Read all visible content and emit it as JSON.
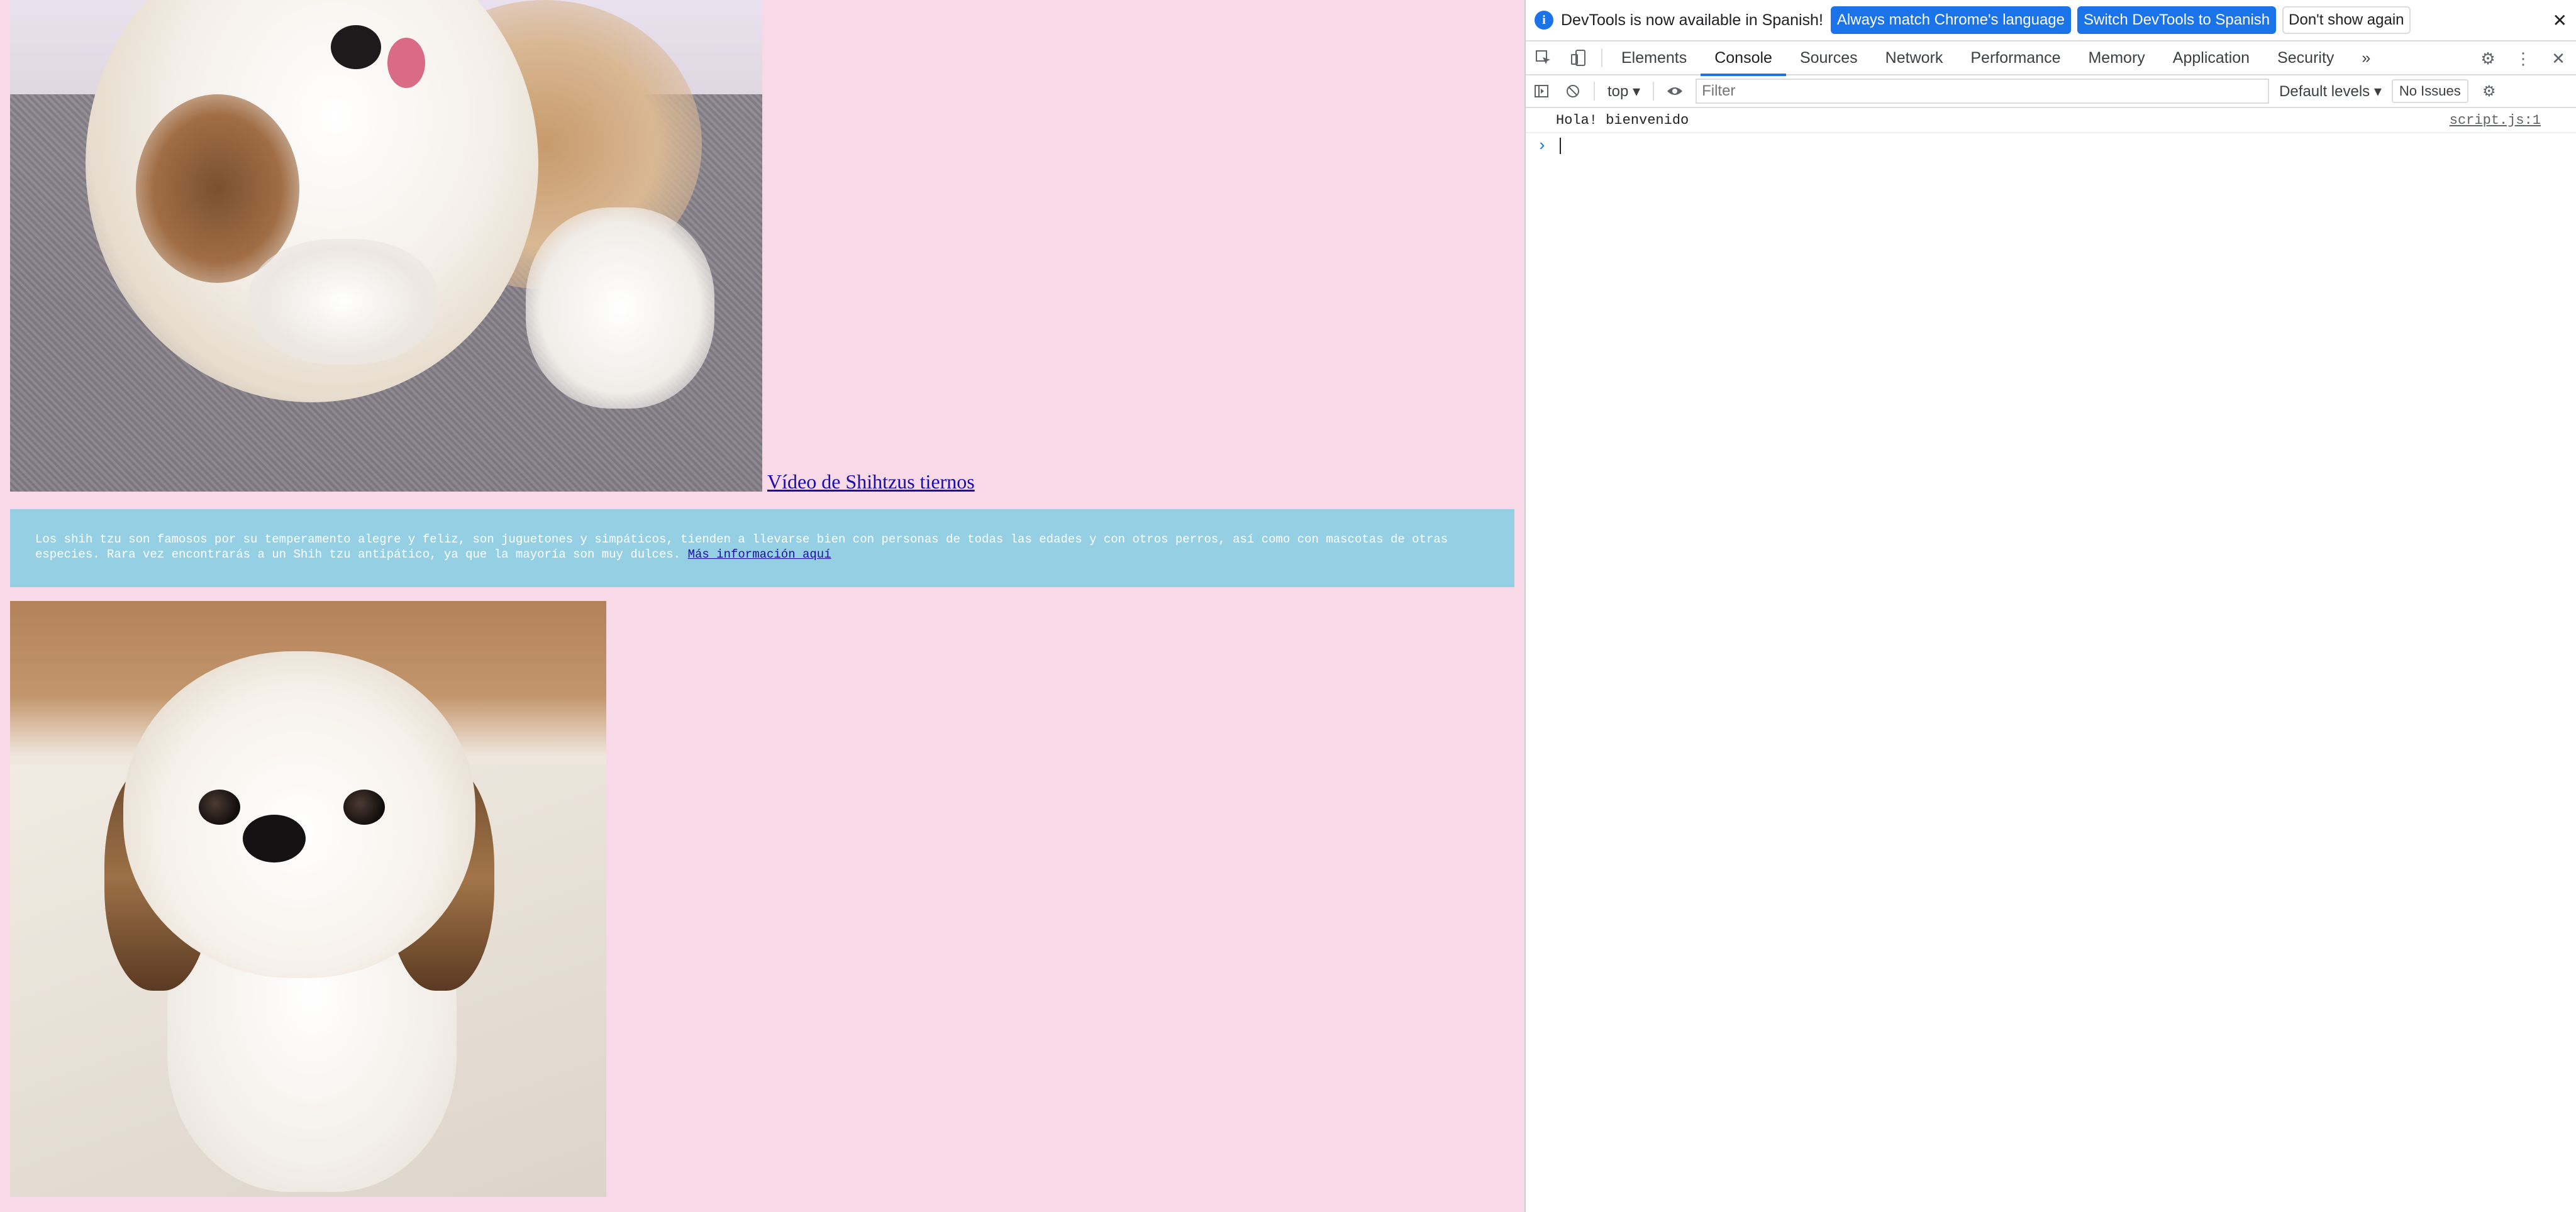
{
  "page": {
    "video_link": "Vídeo de Shihtzus tiernos",
    "info_text": "Los shih tzu son famosos por su temperamento alegre y feliz, son juguetones y simpáticos, tienden a llevarse bien con personas de todas las edades y con otros perros, así como con mascotas de otras especies. Rara vez encontrarás a un Shih tzu antipático, ya que la mayoría son muy dulces.",
    "info_link": "Más información aquí"
  },
  "devtools": {
    "infobar": {
      "message": "DevTools is now available in Spanish!",
      "btn_match": "Always match Chrome's language",
      "btn_switch": "Switch DevTools to Spanish",
      "btn_dismiss": "Don't show again"
    },
    "tabs": [
      "Elements",
      "Console",
      "Sources",
      "Network",
      "Performance",
      "Memory",
      "Application",
      "Security"
    ],
    "active_tab": "Console",
    "toolbar": {
      "context": "top",
      "filter_placeholder": "Filter",
      "levels": "Default levels",
      "issues": "No Issues"
    },
    "console": {
      "messages": [
        {
          "text": "Hola! bienvenido",
          "source": "script.js:1"
        }
      ]
    }
  },
  "colors": {
    "page_bg": "#f7d9e8",
    "info_box_bg": "#95cfe4",
    "link": "#1a0dab",
    "accent": "#1a73e8"
  }
}
